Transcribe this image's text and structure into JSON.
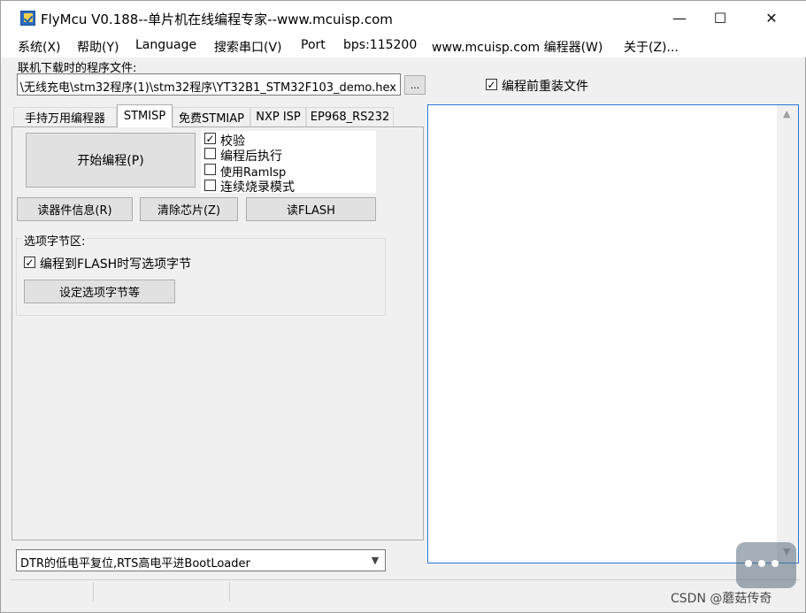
{
  "window": {
    "title": "FlyMcu V0.188--单片机在线编程专家--www.mcuisp.com",
    "minimize_glyph": "—",
    "maximize_glyph": "☐",
    "close_glyph": "✕"
  },
  "menu": {
    "items": [
      "系统(X)",
      "帮助(Y)",
      "Language",
      "搜索串口(V)",
      "Port",
      "bps:115200",
      "www.mcuisp.com 编程器(W)",
      "关于(Z)..."
    ]
  },
  "file": {
    "label": "联机下载时的程序文件:",
    "path": "\\无线充电\\stm32程序(1)\\stm32程序\\YT32B1_STM32F103_demo.hex",
    "browse_label": "...",
    "reload_label": "编程前重装文件",
    "reload_checked": true
  },
  "tabs": [
    {
      "label": "手持万用编程器",
      "active": false
    },
    {
      "label": "STMISP",
      "active": true
    },
    {
      "label": "免费STMIAP",
      "active": false
    },
    {
      "label": "NXP ISP",
      "active": false
    },
    {
      "label": "EP968_RS232",
      "active": false
    }
  ],
  "stmisp": {
    "start_button": "开始编程(P)",
    "options": [
      {
        "label": "校验",
        "checked": true
      },
      {
        "label": "编程后执行",
        "checked": false
      },
      {
        "label": "使用RamIsp",
        "checked": false
      },
      {
        "label": "连续烧录模式",
        "checked": false
      }
    ],
    "read_info_button": "读器件信息(R)",
    "erase_button": "清除芯片(Z)",
    "read_flash_button": "读FLASH",
    "option_bytes": {
      "title": "选项字节区:",
      "write_label": "编程到FLASH时写选项字节",
      "write_checked": true,
      "set_button": "设定选项字节等"
    }
  },
  "bottom": {
    "reset_mode": "DTR的低电平复位,RTS高电平进BootLoader"
  },
  "watermark": "CSDN @蘑菇传奇"
}
